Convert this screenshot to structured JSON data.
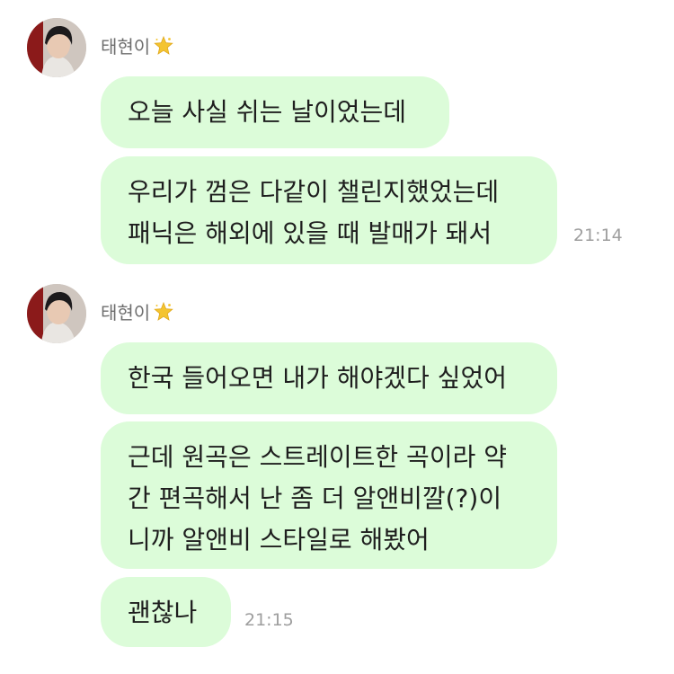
{
  "groups": [
    {
      "sender": {
        "name": "태현이",
        "badge_icon": "star-icon"
      },
      "messages": [
        {
          "lines": [
            "오늘 사실 쉬는 날이었는데"
          ],
          "time": ""
        },
        {
          "lines": [
            "우리가 껌은 다같이 챌린지했었는데",
            "패닉은 해외에 있을 때 발매가 돼서"
          ],
          "time": "21:14"
        }
      ]
    },
    {
      "sender": {
        "name": "태현이",
        "badge_icon": "star-icon"
      },
      "messages": [
        {
          "lines": [
            "한국 들어오면 내가 해야겠다 싶었어"
          ],
          "time": ""
        },
        {
          "lines": [
            "근데 원곡은 스트레이트한 곡이라 약",
            "간 편곡해서 난 좀 더 알앤비깔(?)이",
            "니까 알앤비 스타일로 해봤어"
          ],
          "time": ""
        },
        {
          "lines": [
            "괜찮나"
          ],
          "time": "21:15"
        }
      ]
    }
  ],
  "colors": {
    "bubble": "#dcfcd9",
    "text": "#1e1e1e",
    "sender": "#6e6e6e",
    "time": "#9e9e9e",
    "badge": "#f4c430"
  }
}
